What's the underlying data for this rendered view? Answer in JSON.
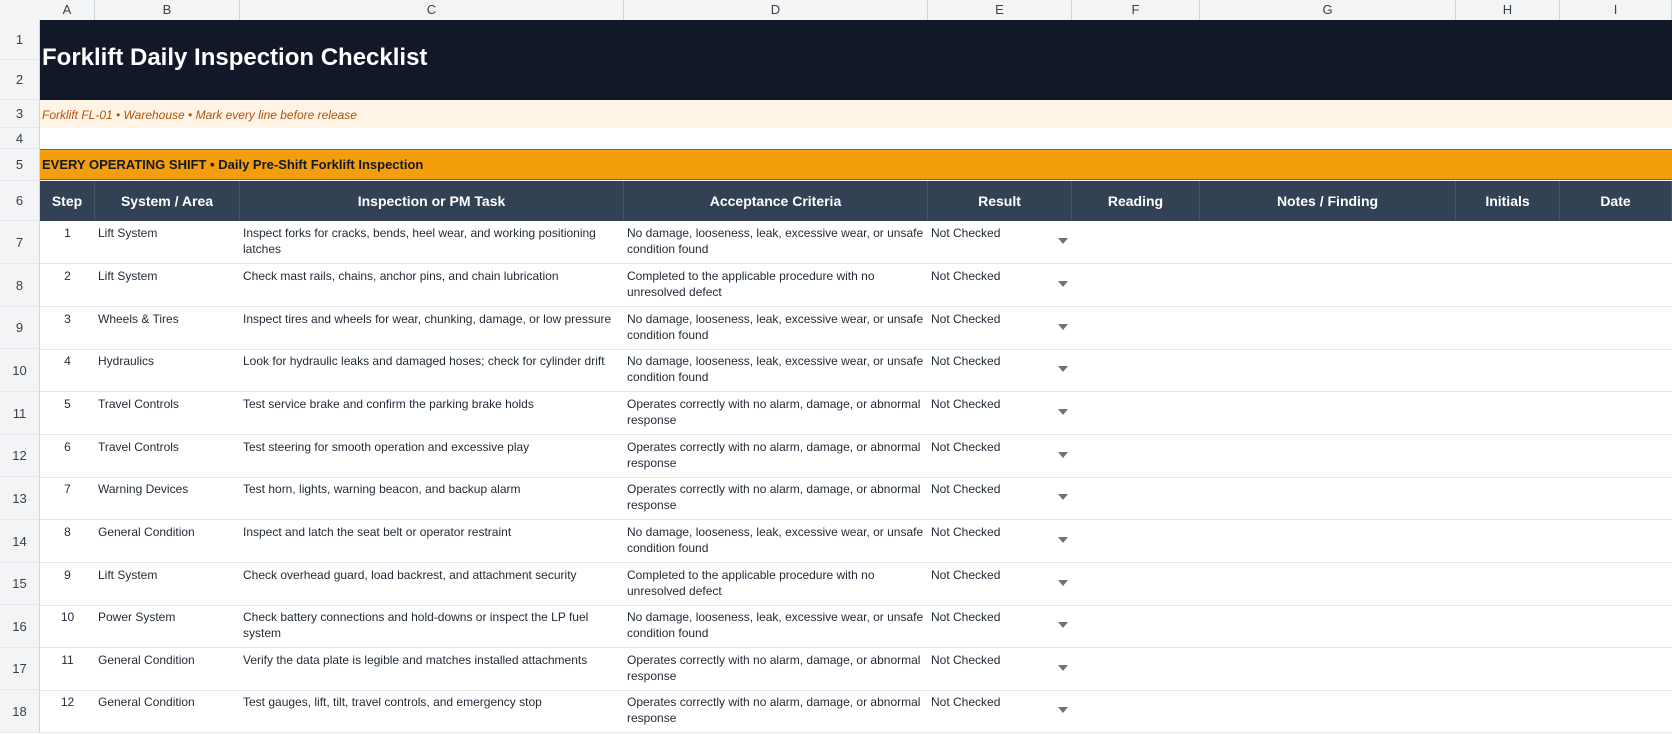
{
  "columns": [
    "A",
    "B",
    "C",
    "D",
    "E",
    "F",
    "G",
    "H",
    "I"
  ],
  "row_numbers": [
    "1",
    "2",
    "3",
    "4",
    "5",
    "6",
    "7",
    "8",
    "9",
    "10",
    "11",
    "12",
    "13",
    "14",
    "15",
    "16",
    "17",
    "18"
  ],
  "title": "Forklift Daily Inspection Checklist",
  "subtitle": "Forklift FL-01 • Warehouse • Mark every line before release",
  "section": "EVERY OPERATING SHIFT  •  Daily Pre-Shift Forklift Inspection",
  "headers": [
    "Step",
    "System / Area",
    "Inspection or PM Task",
    "Acceptance Criteria",
    "Result",
    "Reading",
    "Notes / Finding",
    "Initials",
    "Date"
  ],
  "rows": [
    {
      "step": "1",
      "area": "Lift System",
      "task": "Inspect forks for cracks, bends, heel wear, and working positioning latches",
      "criteria": "No damage, looseness, leak, excessive wear, or unsafe condition found",
      "result": "Not Checked"
    },
    {
      "step": "2",
      "area": "Lift System",
      "task": "Check mast rails, chains, anchor pins, and chain lubrication",
      "criteria": "Completed to the applicable procedure with no unresolved defect",
      "result": "Not Checked"
    },
    {
      "step": "3",
      "area": "Wheels & Tires",
      "task": "Inspect tires and wheels for wear, chunking, damage, or low pressure",
      "criteria": "No damage, looseness, leak, excessive wear, or unsafe condition found",
      "result": "Not Checked"
    },
    {
      "step": "4",
      "area": "Hydraulics",
      "task": "Look for hydraulic leaks and damaged hoses; check for cylinder drift",
      "criteria": "No damage, looseness, leak, excessive wear, or unsafe condition found",
      "result": "Not Checked"
    },
    {
      "step": "5",
      "area": "Travel Controls",
      "task": "Test service brake and confirm the parking brake holds",
      "criteria": "Operates correctly with no alarm, damage, or abnormal response",
      "result": "Not Checked"
    },
    {
      "step": "6",
      "area": "Travel Controls",
      "task": "Test steering for smooth operation and excessive play",
      "criteria": "Operates correctly with no alarm, damage, or abnormal response",
      "result": "Not Checked"
    },
    {
      "step": "7",
      "area": "Warning Devices",
      "task": "Test horn, lights, warning beacon, and backup alarm",
      "criteria": "Operates correctly with no alarm, damage, or abnormal response",
      "result": "Not Checked"
    },
    {
      "step": "8",
      "area": "General Condition",
      "task": "Inspect and latch the seat belt or operator restraint",
      "criteria": "No damage, looseness, leak, excessive wear, or unsafe condition found",
      "result": "Not Checked"
    },
    {
      "step": "9",
      "area": "Lift System",
      "task": "Check overhead guard, load backrest, and attachment security",
      "criteria": "Completed to the applicable procedure with no unresolved defect",
      "result": "Not Checked"
    },
    {
      "step": "10",
      "area": "Power System",
      "task": "Check battery connections and hold-downs or inspect the LP fuel system",
      "criteria": "No damage, looseness, leak, excessive wear, or unsafe condition found",
      "result": "Not Checked"
    },
    {
      "step": "11",
      "area": "General Condition",
      "task": "Verify the data plate is legible and matches installed attachments",
      "criteria": "Operates correctly with no alarm, damage, or abnormal response",
      "result": "Not Checked"
    },
    {
      "step": "12",
      "area": "General Condition",
      "task": "Test gauges, lift, tilt, travel controls, and emergency stop",
      "criteria": "Operates correctly with no alarm, damage, or abnormal response",
      "result": "Not Checked"
    }
  ]
}
